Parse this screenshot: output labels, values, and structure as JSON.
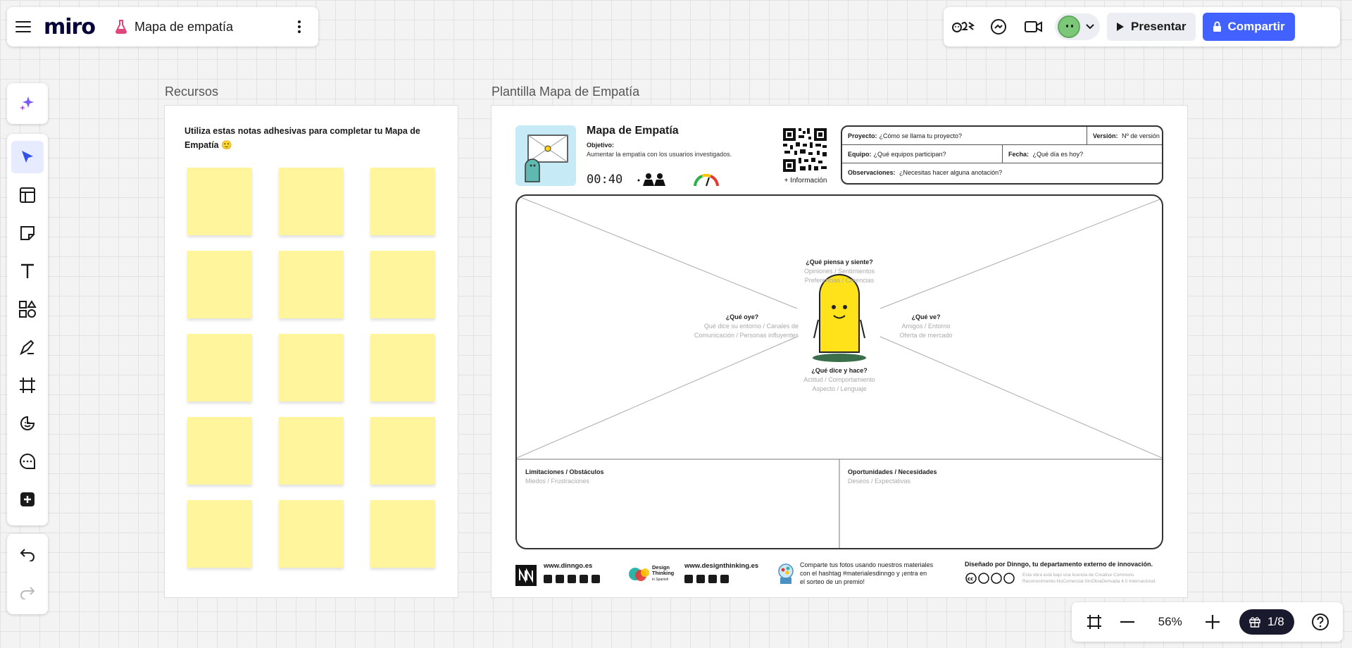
{
  "app": {
    "logo": "miro",
    "board_title": "Mapa de empatía"
  },
  "topbar": {
    "present_label": "Presentar",
    "share_label": "Compartir"
  },
  "frames": {
    "resources": {
      "label": "Recursos",
      "instruction": "Utiliza estas notas adhesivas para completar tu Mapa de Empatía 🙂",
      "sticky_color": "#fff59d",
      "sticky_count": 15
    },
    "template": {
      "label": "Plantilla Mapa de Empatía",
      "title": "Mapa de Empatía",
      "objective_label": "Objetivo:",
      "objective": "Aumentar la empatía con los usuarios investigados.",
      "timer": "00:40",
      "qr_label": "+ Información",
      "info": {
        "project_label": "Proyecto:",
        "project": "¿Cómo se llama tu proyecto?",
        "version_label": "Versión:",
        "version": "Nº de versión",
        "team_label": "Equipo:",
        "team": "¿Qué equipos participan?",
        "date_label": "Fecha:",
        "date": "¿Qué día es hoy?",
        "notes_label": "Observaciones:",
        "notes": "¿Necesitas hacer alguna anotación?"
      },
      "quadrants": {
        "think": {
          "title": "¿Qué piensa y siente?",
          "line1": "Opiniones / Sentimientos",
          "line2": "Preferencias / Creencias"
        },
        "hear": {
          "title": "¿Qué oye?",
          "line1": "Qué dice su entorno / Canales de",
          "line2": "Comunicación / Personas influyentes"
        },
        "see": {
          "title": "¿Qué ve?",
          "line1": "Amigos / Entorno",
          "line2": "Oferta de mercado"
        },
        "say": {
          "title": "¿Qué dice y hace?",
          "line1": "Actitud / Comportamiento",
          "line2": "Aspecto / Lenguaje"
        }
      },
      "limits": {
        "title": "Limitaciones / Obstáculos",
        "sub": "Miedos / Frustraciones"
      },
      "opportunities": {
        "title": "Oportunidades / Necesidades",
        "sub": "Deseos / Expectativas"
      },
      "footer": {
        "dinngo_url": "www.dinngo.es",
        "dt_url": "www.designthinking.es",
        "dt_logo_line1": "Design",
        "dt_logo_line2": "Thinking",
        "dt_logo_line3": "in Spanish",
        "share_text_1": "Comparte tus fotos usando nuestros materiales",
        "share_text_2": "con el hashtag #materialesdinngo y ¡entra en",
        "share_text_3": "el sorteo de un premio!",
        "designed_by": "Diseñado por Dinngo, tu departamento externo de innovación.",
        "license_1": "Esta obra está bajo una licencia de Creative Commons",
        "license_2": "Reconocimiento-NoComercial-SinObraDerivada 4.0 Internacional."
      }
    }
  },
  "zoom": {
    "level": "56%",
    "page": "1/8"
  },
  "colors": {
    "accent": "#4262ff",
    "sticky": "#fff59d",
    "canvas": "#f3f3f3"
  }
}
